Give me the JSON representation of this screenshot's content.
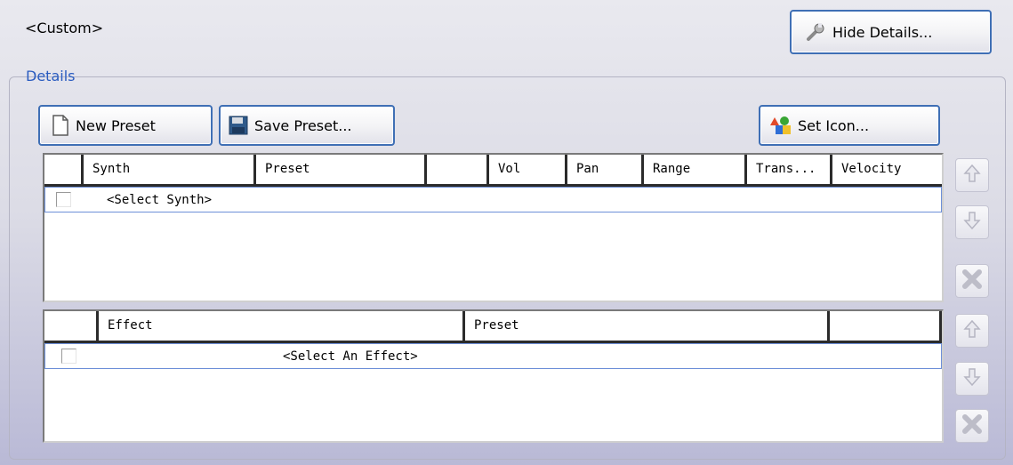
{
  "preset_name": "<Custom>",
  "hide_details_label": "Hide Details...",
  "details_group_label": "Details",
  "toolbar": {
    "new_preset_label": "New Preset",
    "save_preset_label": "Save Preset...",
    "set_icon_label": "Set Icon..."
  },
  "synth_table": {
    "columns": [
      "",
      "Synth",
      "Preset",
      "",
      "Vol",
      "Pan",
      "Range",
      "Trans...",
      "Velocity"
    ],
    "rows": [
      {
        "checked": false,
        "synth": "<Select Synth>"
      }
    ]
  },
  "effect_table": {
    "columns": [
      "",
      "Effect",
      "Preset",
      ""
    ],
    "rows": [
      {
        "checked": false,
        "effect": "<Select An Effect>"
      }
    ]
  },
  "icons": {
    "hide_details": "wrench-icon",
    "new_preset": "document-icon",
    "save_preset": "floppy-disk-icon",
    "set_icon": "shapes-icon",
    "move_up": "arrow-up-icon",
    "move_down": "arrow-down-icon",
    "delete": "x-icon"
  },
  "colors": {
    "accent_border": "#3f6fb5",
    "group_label": "#2a5cc0",
    "row_highlight_border": "#6d8fd8"
  }
}
